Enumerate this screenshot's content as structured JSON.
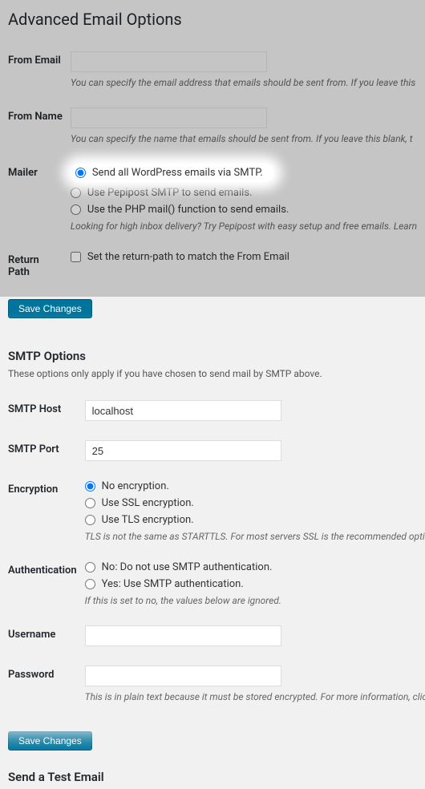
{
  "top_heading": "Advanced Email Options",
  "from_email": {
    "label": "From Email",
    "value": "",
    "desc": "You can specify the email address that emails should be sent from. If you leave this"
  },
  "from_name": {
    "label": "From Name",
    "value": "",
    "desc": "You can specify the name that emails should be sent from. If you leave this blank, t"
  },
  "mailer": {
    "label": "Mailer",
    "opt_smtp": "Send all WordPress emails via SMTP.",
    "opt_pepipost": "Use Pepipost SMTP to send emails.",
    "opt_php": "Use the PHP mail() function to send emails.",
    "desc": "Looking for high inbox delivery? Try Pepipost with easy setup and free emails. Learn"
  },
  "return_path": {
    "label": "Return Path",
    "opt": "Set the return-path to match the From Email"
  },
  "save_label": "Save Changes",
  "smtp_heading": "SMTP Options",
  "smtp_sub": "These options only apply if you have chosen to send mail by SMTP above.",
  "smtp_host": {
    "label": "SMTP Host",
    "value": "localhost"
  },
  "smtp_port": {
    "label": "SMTP Port",
    "value": "25"
  },
  "encryption": {
    "label": "Encryption",
    "opt_none": "No encryption.",
    "opt_ssl": "Use SSL encryption.",
    "opt_tls": "Use TLS encryption.",
    "desc": "TLS is not the same as STARTTLS. For most servers SSL is the recommended option."
  },
  "auth": {
    "label": "Authentication",
    "opt_no": "No: Do not use SMTP authentication.",
    "opt_yes": "Yes: Use SMTP authentication.",
    "desc": "If this is set to no, the values below are ignored."
  },
  "username": {
    "label": "Username",
    "value": ""
  },
  "password": {
    "label": "Password",
    "value": "",
    "desc": "This is in plain text because it must be stored encrypted. For more information, click"
  },
  "test_heading": "Send a Test Email"
}
